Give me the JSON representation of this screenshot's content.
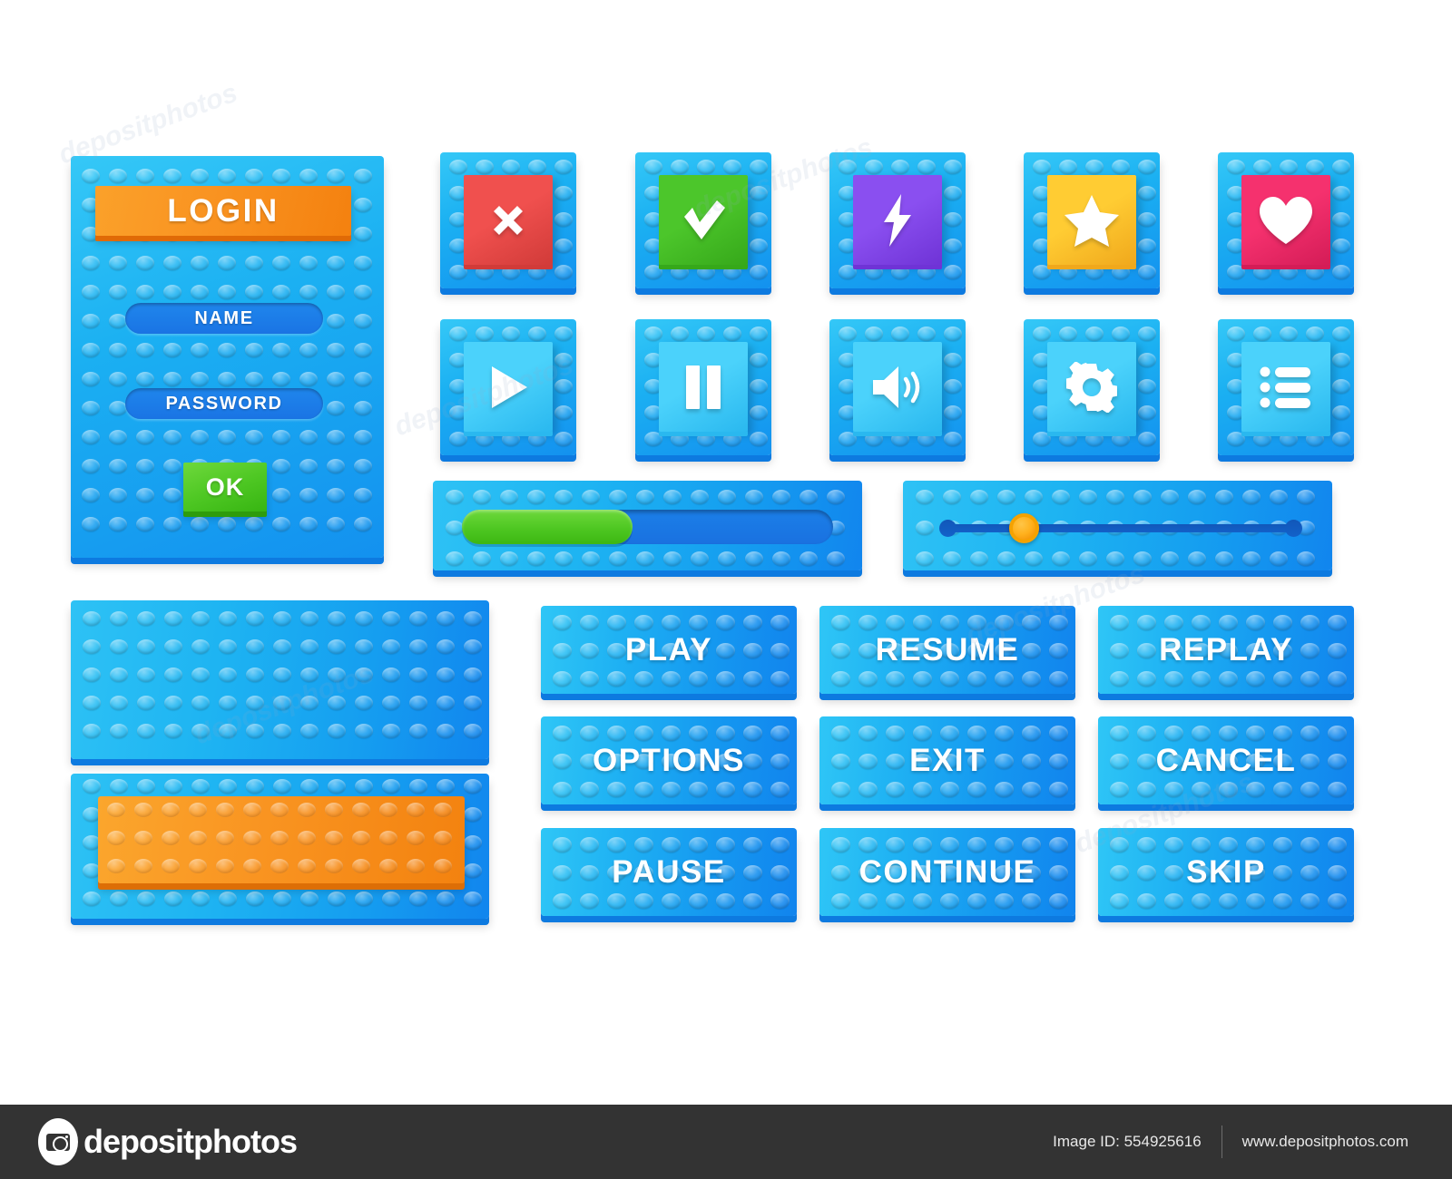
{
  "login_panel": {
    "title": "LOGIN",
    "name_field": {
      "value": "NAME",
      "placeholder": "NAME"
    },
    "password_field": {
      "value": "PASSWORD",
      "placeholder": "PASSWORD"
    },
    "ok_label": "OK"
  },
  "icon_buttons": [
    {
      "name": "close-icon",
      "label": "X",
      "color": "#f0504e",
      "color_dark": "#d13b39",
      "row": 1
    },
    {
      "name": "check-icon",
      "label": "Check",
      "color": "#4cc62b",
      "color_dark": "#36a81a",
      "row": 1
    },
    {
      "name": "lightning-icon",
      "label": "Lightning",
      "color": "#8a4ff0",
      "color_dark": "#6f33d6",
      "row": 1
    },
    {
      "name": "star-icon",
      "label": "Star",
      "color": "#ffcc33",
      "color_dark": "#f0a81c",
      "row": 1
    },
    {
      "name": "heart-icon",
      "label": "Heart",
      "color": "#f5316e",
      "color_dark": "#d41c57",
      "row": 1
    },
    {
      "name": "play-icon",
      "label": "Play",
      "color": "#4bd2fb",
      "color_dark": "#2ab8ef",
      "row": 2
    },
    {
      "name": "pause-icon",
      "label": "Pause",
      "color": "#4bd2fb",
      "color_dark": "#2ab8ef",
      "row": 2
    },
    {
      "name": "sound-icon",
      "label": "Sound",
      "color": "#4bd2fb",
      "color_dark": "#2ab8ef",
      "row": 2
    },
    {
      "name": "gear-icon",
      "label": "Settings",
      "color": "#4bd2fb",
      "color_dark": "#2ab8ef",
      "row": 2
    },
    {
      "name": "list-icon",
      "label": "List",
      "color": "#4bd2fb",
      "color_dark": "#2ab8ef",
      "row": 2
    }
  ],
  "progress_bar": {
    "value": 46,
    "fill_color": "#4ec722",
    "track_color": "#1a74e4"
  },
  "slider": {
    "value": 23,
    "knob_color": "#ffb01c",
    "track_color": "#1361c9"
  },
  "panels": {
    "plain_panel_label": "",
    "orange_panel_label": ""
  },
  "text_buttons": [
    {
      "label": "PLAY"
    },
    {
      "label": "RESUME"
    },
    {
      "label": "REPLAY"
    },
    {
      "label": "OPTIONS"
    },
    {
      "label": "EXIT"
    },
    {
      "label": "CANCEL"
    },
    {
      "label": "PAUSE"
    },
    {
      "label": "CONTINUE"
    },
    {
      "label": "SKIP"
    }
  ],
  "footer": {
    "brand": "depositphotos",
    "image_id": "Image ID: 554925616",
    "website": "www.depositphotos.com"
  },
  "watermarks": [
    "depositphotos",
    "depositphotos",
    "depositphotos",
    "depositphotos",
    "depositphotos",
    "depositphotos"
  ],
  "colors": {
    "brick_blue_light": "#2ec2f5",
    "brick_blue_dark": "#1185ee",
    "brick_edge": "#0d7ae0",
    "orange": "#f99421",
    "green": "#4ec722",
    "footer_bg": "#333333"
  }
}
